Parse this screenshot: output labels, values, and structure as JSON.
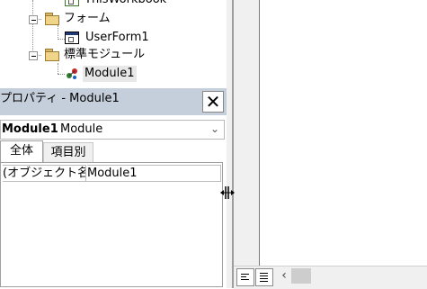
{
  "tree": {
    "items": [
      {
        "label": "ThisWorkbook"
      },
      {
        "label": "フォーム"
      },
      {
        "label": "UserForm1"
      },
      {
        "label": "標準モジュール"
      },
      {
        "label": "Module1"
      }
    ]
  },
  "properties": {
    "title": "プロパティ - Module1",
    "close_label": "✕",
    "object_name": "Module1",
    "object_type": "Module",
    "tabs": [
      {
        "label": "全体"
      },
      {
        "label": "項目別"
      }
    ],
    "grid": [
      {
        "key": "(オブジェクト名)",
        "value": "Module1"
      }
    ]
  }
}
